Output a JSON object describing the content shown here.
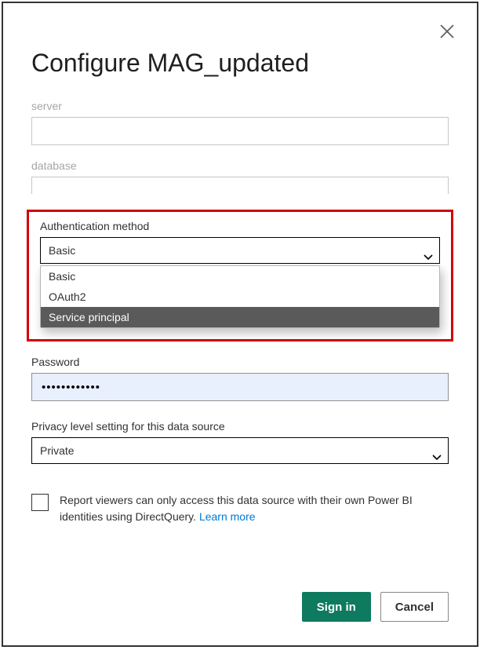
{
  "title": "Configure MAG_updated",
  "fields": {
    "server": {
      "label": "server",
      "value": ""
    },
    "database": {
      "label": "database",
      "value": ""
    }
  },
  "auth": {
    "label": "Authentication method",
    "selected": "Basic",
    "options": [
      "Basic",
      "OAuth2",
      "Service principal"
    ],
    "highlighted_option": "Service principal"
  },
  "password": {
    "label": "Password",
    "value": "••••••••••••"
  },
  "privacy": {
    "label": "Privacy level setting for this data source",
    "selected": "Private"
  },
  "consent": {
    "text": "Report viewers can only access this data source with their own Power BI identities using DirectQuery. ",
    "learn_more": "Learn more"
  },
  "buttons": {
    "signin": "Sign in",
    "cancel": "Cancel"
  }
}
